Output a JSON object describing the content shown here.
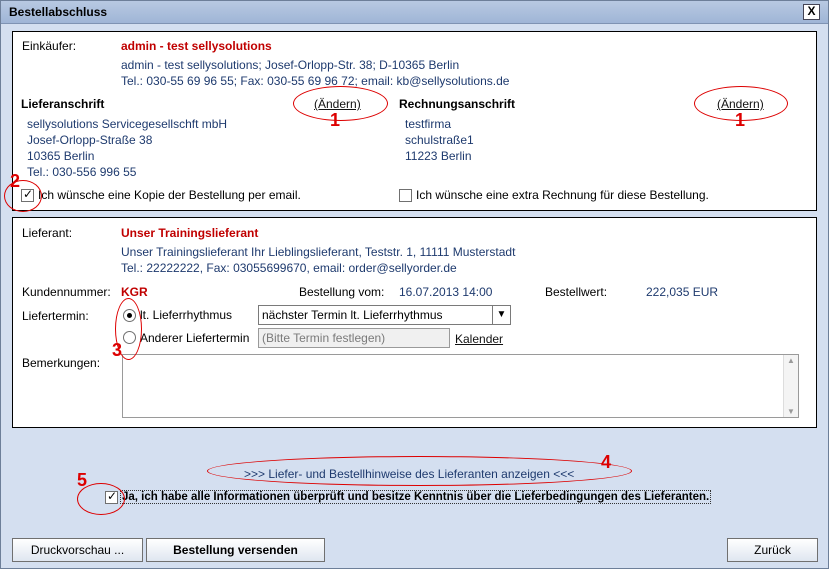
{
  "window": {
    "title": "Bestellabschluss",
    "close": "X"
  },
  "buyer": {
    "label": "Einkäufer:",
    "name": "admin - test sellysolutions",
    "line1": "admin - test sellysolutions; Josef-Orlopp-Str. 38; D-10365 Berlin",
    "line2": "Tel.: 030-55 69 96 55; Fax: 030-55 69 96 72; email: kb@sellysolutions.de"
  },
  "delivery": {
    "title": "Lieferanschrift",
    "change": "(Ändern)",
    "lines": [
      "sellysolutions Servicegesellschft mbH",
      "Josef-Orlopp-Straße 38",
      "10365 Berlin",
      "Tel.: 030-556 996 55"
    ]
  },
  "invoice": {
    "title": "Rechnungsanschrift",
    "change": "(Ändern)",
    "lines": [
      "testfirma",
      "schulstraße1",
      "11223 Berlin"
    ]
  },
  "options": {
    "copy_email": "Ich wünsche eine Kopie der Bestellung per email.",
    "extra_invoice": "Ich wünsche eine extra Rechnung für diese Bestellung."
  },
  "supplier": {
    "label": "Lieferant:",
    "name": "Unser Trainingslieferant",
    "line1": "Unser Trainingslieferant Ihr Lieblingslieferant, Teststr. 1, 11111 Musterstadt",
    "line2": "Tel.: 22222222, Fax: 03055699670, email: order@sellyorder.de"
  },
  "order": {
    "customer_label": "Kundennummer:",
    "customer_value": "KGR",
    "date_label": "Bestellung vom:",
    "date_value": "16.07.2013 14:00",
    "value_label": "Bestellwert:",
    "value_value": "222,035 EUR"
  },
  "term": {
    "label": "Liefertermin:",
    "radio1": "lt. Lieferrhythmus",
    "radio2": "Anderer Liefertermin",
    "select_value": "nächster Termin lt. Lieferrhythmus",
    "date_placeholder": "(Bitte Termin festlegen)",
    "calendar": "Kalender"
  },
  "remarks": {
    "label": "Bemerkungen:"
  },
  "hints": {
    "link": ">>> Liefer- und Bestellhinweise des Lieferanten anzeigen <<<"
  },
  "confirm": {
    "text": "Ja, ich habe alle Informationen überprüft und besitze Kenntnis über die Lieferbedingungen des Lieferanten."
  },
  "buttons": {
    "preview": "Druckvorschau ...",
    "send": "Bestellung versenden",
    "back": "Zurück"
  },
  "annotations": [
    "1",
    "1",
    "2",
    "3",
    "4",
    "5"
  ]
}
